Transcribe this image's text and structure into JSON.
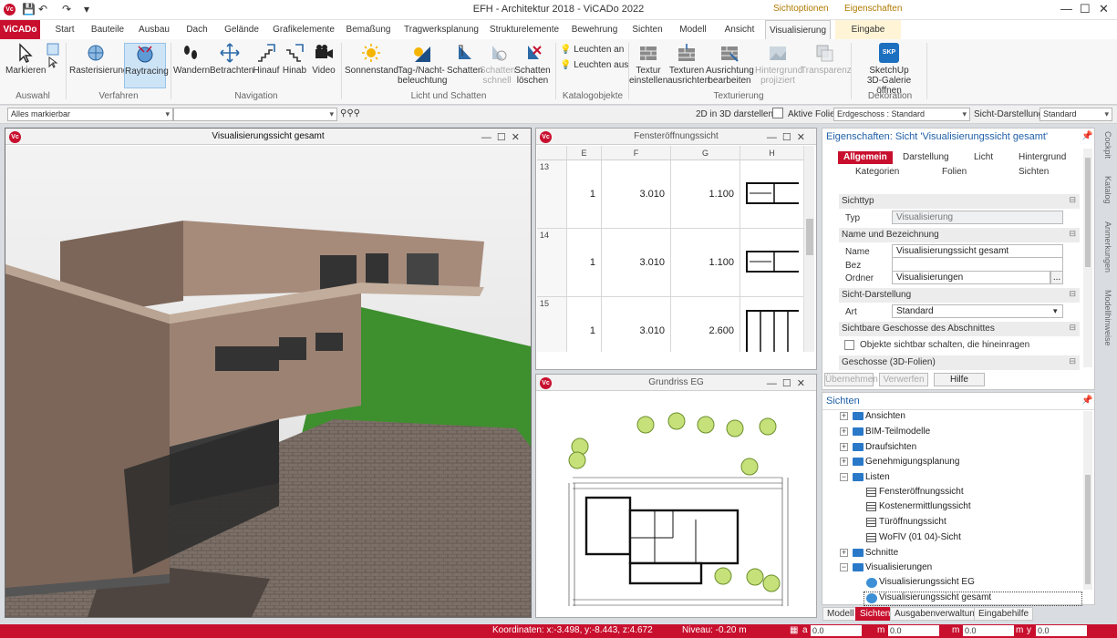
{
  "titlebar": {
    "title": "EFH - Architektur 2018 - ViCADo 2022",
    "context_tabs": [
      "Sichtoptionen",
      "Eigenschaften"
    ]
  },
  "tabs": [
    "ViCADo",
    "Start",
    "Bauteile",
    "Ausbau",
    "Dach",
    "Gelände",
    "Grafikelemente",
    "Bemaßung",
    "Tragwerksplanung",
    "Strukturelemente",
    "Bewehrung",
    "Sichten",
    "Modell",
    "Ansicht",
    "Visualisierung",
    "Eingabe"
  ],
  "active_tab": "Visualisierung",
  "ribbon": {
    "auswahl": {
      "markieren": "Markieren",
      "group": "Auswahl"
    },
    "verfahren": {
      "raster": "Rasterisierung",
      "ray": "Raytracing",
      "group": "Verfahren"
    },
    "navigation": {
      "items": [
        "Wandern",
        "Betrachten",
        "Hinauf",
        "Hinab",
        "Video"
      ],
      "group": "Navigation"
    },
    "licht": {
      "sonne": "Sonnenstand",
      "tag1": "Tag-/Nacht-",
      "tag2": "beleuchtung",
      "schatten": "Schatten",
      "schnell1": "Schatten",
      "schnell2": "schnell",
      "loeschen1": "Schatten",
      "loeschen2": "löschen",
      "group": "Licht und Schatten"
    },
    "katalog": {
      "an": "Leuchten an",
      "aus": "Leuchten aus",
      "group": "Katalogobjekte"
    },
    "textur": {
      "t1a": "Textur",
      "t1b": "einstellen",
      "t2a": "Texturen",
      "t2b": "ausrichten",
      "t3a": "Ausrichtung",
      "t3b": "bearbeiten",
      "t4a": "Hintergrund",
      "t4b": "projiziert",
      "t5": "Transparenz",
      "group": "Texturierung"
    },
    "deko": {
      "d1": "SketchUp",
      "d2": "3D-Galerie öffnen",
      "group": "Dekoration",
      "badge": "SKP"
    }
  },
  "strip": {
    "select": "Alles markierbar",
    "label_2d": "2D in 3D darstellen:",
    "label_folie": "Aktive Folie:",
    "folie": "Erdgeschoss : Standard",
    "label_sicht": "Sicht-Darstellung:",
    "sicht": "Standard"
  },
  "windows": {
    "visual": "Visualisierungssicht gesamt",
    "fenster": "Fensteröffnungssicht",
    "grundriss": "Grundriss EG"
  },
  "ftable": {
    "columns": [
      "E",
      "F",
      "G",
      "H"
    ],
    "rows": [
      {
        "n": "13",
        "e": "1",
        "f": "3.010",
        "g": "1.100"
      },
      {
        "n": "14",
        "e": "1",
        "f": "3.010",
        "g": "1.100"
      },
      {
        "n": "15",
        "e": "1",
        "f": "3.010",
        "g": "2.600"
      }
    ]
  },
  "props": {
    "header": "Eigenschaften: Sicht 'Visualisierungssicht gesamt'",
    "tabs": [
      "Allgemein",
      "Darstellung",
      "Licht",
      "Hintergrund",
      "Kategorien",
      "Folien",
      "Sichten"
    ],
    "sichttyp": "Sichttyp",
    "typ_l": "Typ",
    "typ_v": "Visualisierung",
    "name_sec": "Name und Bezeichnung",
    "name_l": "Name",
    "name_v": "Visualisierungssicht gesamt",
    "bez_l": "Bez",
    "ordner_l": "Ordner",
    "ordner_v": "Visualisierungen",
    "dots": "...",
    "sd_sec": "Sicht-Darstellung",
    "art_l": "Art",
    "art_v": "Standard",
    "geschosse_sec": "Sichtbare Geschosse des Abschnittes",
    "check_l": "Objekte sichtbar schalten, die hineinragen",
    "folien_sec": "Geschosse (3D-Folien)",
    "btn_apply": "Übernehmen",
    "btn_discard": "Verwerfen",
    "btn_help": "Hilfe"
  },
  "tree": {
    "header": "Sichten",
    "items": [
      "Ansichten",
      "BIM-Teilmodelle",
      "Draufsichten",
      "Genehmigungsplanung",
      "Listen",
      "Fensteröffnungssicht",
      "Kostenermittlungssicht",
      "Türöffnungssicht",
      "WoFlV (01 04)-Sicht",
      "Schnitte",
      "Visualisierungen",
      "Visualisierungssicht EG",
      "Visualisierungssicht gesamt"
    ],
    "bottom_tabs": [
      "Modell",
      "Sichten",
      "Ausgabenverwaltung",
      "Eingabehilfe"
    ]
  },
  "sidetabs": [
    "Cockpit",
    "Katalog",
    "Anmerkungen",
    "Modellhinweise"
  ],
  "status": {
    "coords": "Koordinaten: x:-3.498, y:-8.443, z:4.672",
    "niveau": "Niveau: -0.20 m",
    "labels": [
      "a",
      "m",
      "m",
      "m",
      "y"
    ],
    "values": [
      "0.0",
      "0.0",
      "0.0",
      "0.0",
      "0.0"
    ]
  },
  "colors": {
    "accent": "#c8102e",
    "link": "#1f5fa8"
  }
}
